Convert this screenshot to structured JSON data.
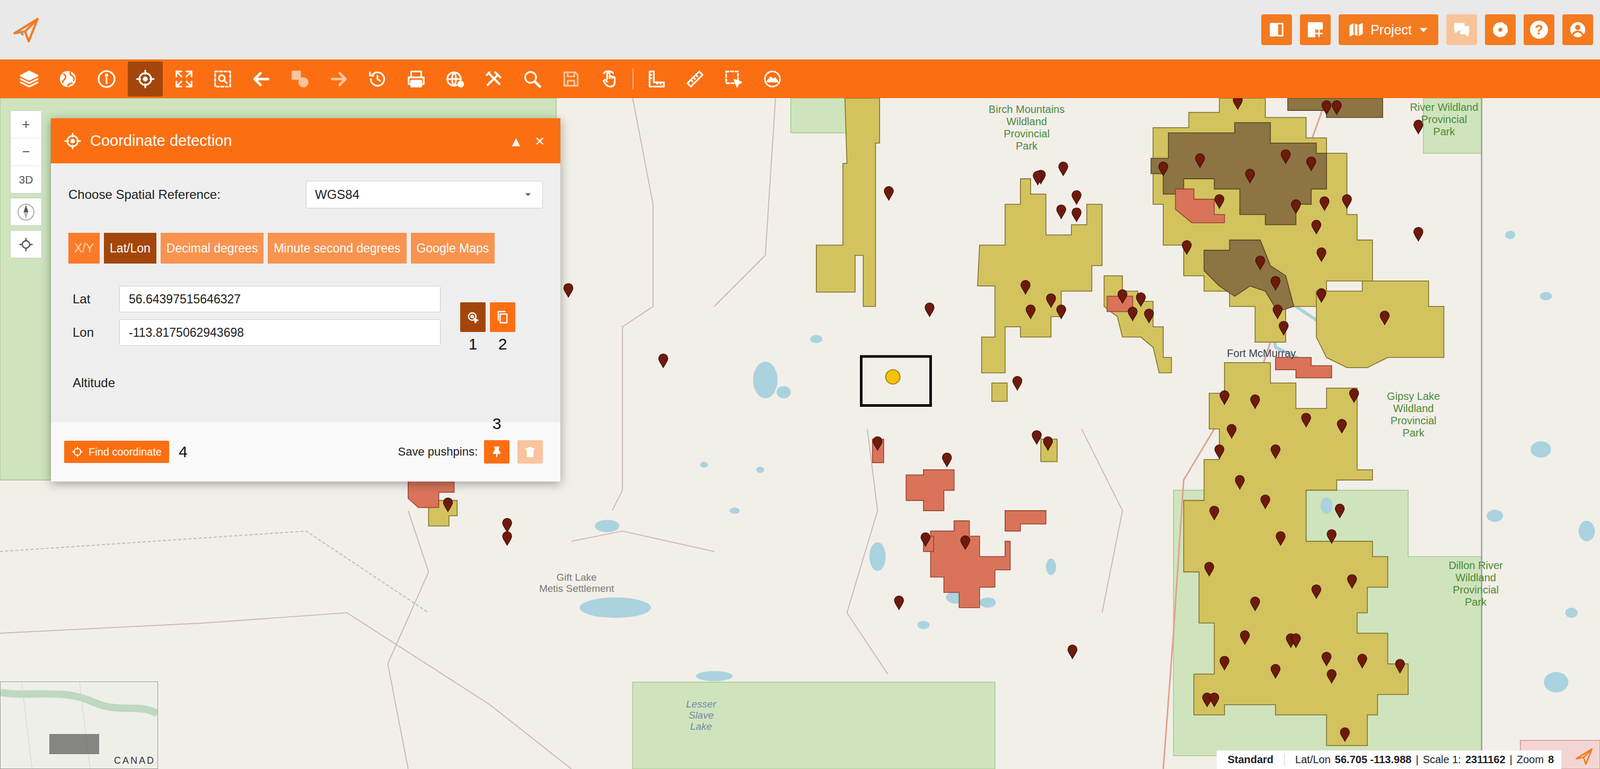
{
  "top_bar": {
    "buttons": [
      {
        "kind": "icon",
        "disabled": false
      },
      {
        "kind": "icon",
        "disabled": false
      },
      {
        "kind": "dropdown",
        "label": "Project",
        "disabled": false
      },
      {
        "kind": "icon",
        "disabled": true
      },
      {
        "kind": "icon",
        "disabled": false
      },
      {
        "kind": "glyph",
        "glyph": "?",
        "disabled": false
      },
      {
        "kind": "icon",
        "disabled": false
      }
    ]
  },
  "toolbar": [
    {
      "selected": false,
      "disabled": false
    },
    {
      "selected": false,
      "disabled": false
    },
    {
      "selected": false,
      "disabled": false
    },
    {
      "selected": true,
      "disabled": false
    },
    {
      "selected": false,
      "disabled": false
    },
    {
      "selected": false,
      "disabled": false
    },
    {
      "selected": false,
      "disabled": false
    },
    {
      "selected": false,
      "disabled": true
    },
    {
      "selected": false,
      "disabled": true
    },
    {
      "selected": false,
      "disabled": false
    },
    {
      "selected": false,
      "disabled": false
    },
    {
      "selected": false,
      "disabled": false
    },
    {
      "selected": false,
      "disabled": false
    },
    {
      "selected": false,
      "disabled": false
    },
    {
      "selected": false,
      "disabled": true
    },
    {
      "selected": false,
      "disabled": false
    },
    {
      "selected": false,
      "disabled": false
    },
    {
      "selected": false,
      "disabled": false
    },
    {
      "selected": false,
      "disabled": false
    },
    {
      "selected": false,
      "disabled": false
    }
  ],
  "map_controls": {
    "zoom_in": "+",
    "zoom_out": "−",
    "three_d": "3D"
  },
  "dialog": {
    "title": "Coordinate detection",
    "header_buttons": [
      "▴",
      "×"
    ],
    "spatial_reference": {
      "label": "Choose Spatial Reference:",
      "value": "WGS84"
    },
    "tabs": [
      {
        "label": "X/Y",
        "selected": false,
        "disabled": true
      },
      {
        "label": "Lat/Lon",
        "selected": true,
        "disabled": false
      },
      {
        "label": "Decimal degrees",
        "selected": false,
        "disabled": false
      },
      {
        "label": "Minute second degrees",
        "selected": false,
        "disabled": false
      },
      {
        "label": "Google Maps",
        "selected": false,
        "disabled": false
      }
    ],
    "fields": [
      {
        "label": "Lat",
        "value": "56.64397515646327"
      },
      {
        "label": "Lon",
        "value": "-113.8175062943698"
      }
    ],
    "actions": [
      {
        "number": "1",
        "selected": true
      },
      {
        "number": "2",
        "selected": false
      }
    ],
    "altitude": {
      "label": "Altitude"
    },
    "find_button": {
      "label": "Find coordinate",
      "number": "4"
    },
    "pushpins": {
      "label": "Save pushpins:",
      "save_number": "3",
      "delete_disabled": true
    }
  },
  "map_labels": [
    {
      "kind": "park",
      "lines": [
        "Birch Mountains",
        "Wildland",
        "Provincial",
        "Park"
      ]
    },
    {
      "kind": "park",
      "lines": [
        "River Wildland",
        "Provincial",
        "Park"
      ]
    },
    {
      "kind": "place",
      "lines": [
        "Fort McMurray"
      ]
    },
    {
      "kind": "park",
      "lines": [
        "Gipsy Lake",
        "Wildland",
        "Provincial",
        "Park"
      ]
    },
    {
      "kind": "park",
      "lines": [
        "Dillon River",
        "Wildland",
        "Provincial",
        "Park"
      ]
    },
    {
      "kind": "settlement",
      "lines": [
        "Gift Lake",
        "Metis Settlement"
      ]
    },
    {
      "kind": "water",
      "lines": [
        "Lesser",
        "Slave",
        "Lake"
      ]
    }
  ],
  "minimap": {
    "label": "CANAD"
  },
  "status_bar": {
    "mode": "Standard",
    "parts": [
      {
        "text": "Lat/Lon",
        "bold": false
      },
      {
        "text": "56.705 -113.988",
        "bold": true
      },
      {
        "text": "|",
        "bold": false
      },
      {
        "text": "Scale 1:",
        "bold": false
      },
      {
        "text": "2311162",
        "bold": true
      },
      {
        "text": "|",
        "bold": false
      },
      {
        "text": "Zoom",
        "bold": false
      },
      {
        "text": "8",
        "bold": true
      }
    ]
  }
}
